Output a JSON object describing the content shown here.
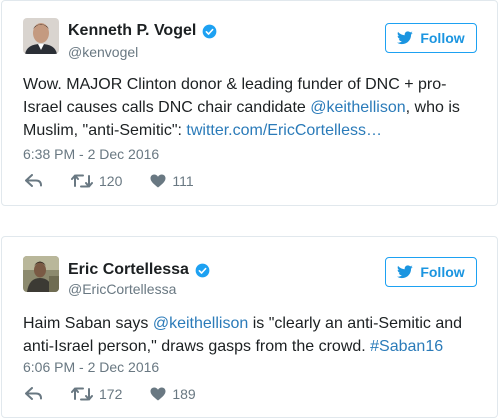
{
  "tweets": [
    {
      "name": "Kenneth P. Vogel",
      "handle": "@kenvogel",
      "follow_label": "Follow",
      "text_before": "Wow. MAJOR Clinton donor & leading funder of DNC + pro-Israel causes calls DNC chair candidate ",
      "mention": "@keithellison",
      "text_middle": ", who is Muslim, \"anti-Semitic\": ",
      "link": "twitter.com/EricCortelless…",
      "timestamp": "6:38 PM - 2 Dec 2016",
      "retweets": "120",
      "likes": "111"
    },
    {
      "name": "Eric Cortellessa",
      "handle": "@EricCortellessa",
      "follow_label": "Follow",
      "text_before": "Haim Saban says ",
      "mention": "@keithellison",
      "text_middle": " is \"clearly an anti-Semitic and anti-Israel person,\" draws gasps from the crowd. ",
      "hashtag": "#Saban16",
      "timestamp": "6:06 PM - 2 Dec 2016",
      "retweets": "172",
      "likes": "189"
    }
  ],
  "colors": {
    "accent": "#1da1f2",
    "link": "#2b7bb9",
    "muted": "#697882",
    "border": "#e1e8ed"
  },
  "icons": [
    "verified-badge-icon",
    "twitter-bird-icon",
    "reply-icon",
    "retweet-icon",
    "heart-icon"
  ]
}
